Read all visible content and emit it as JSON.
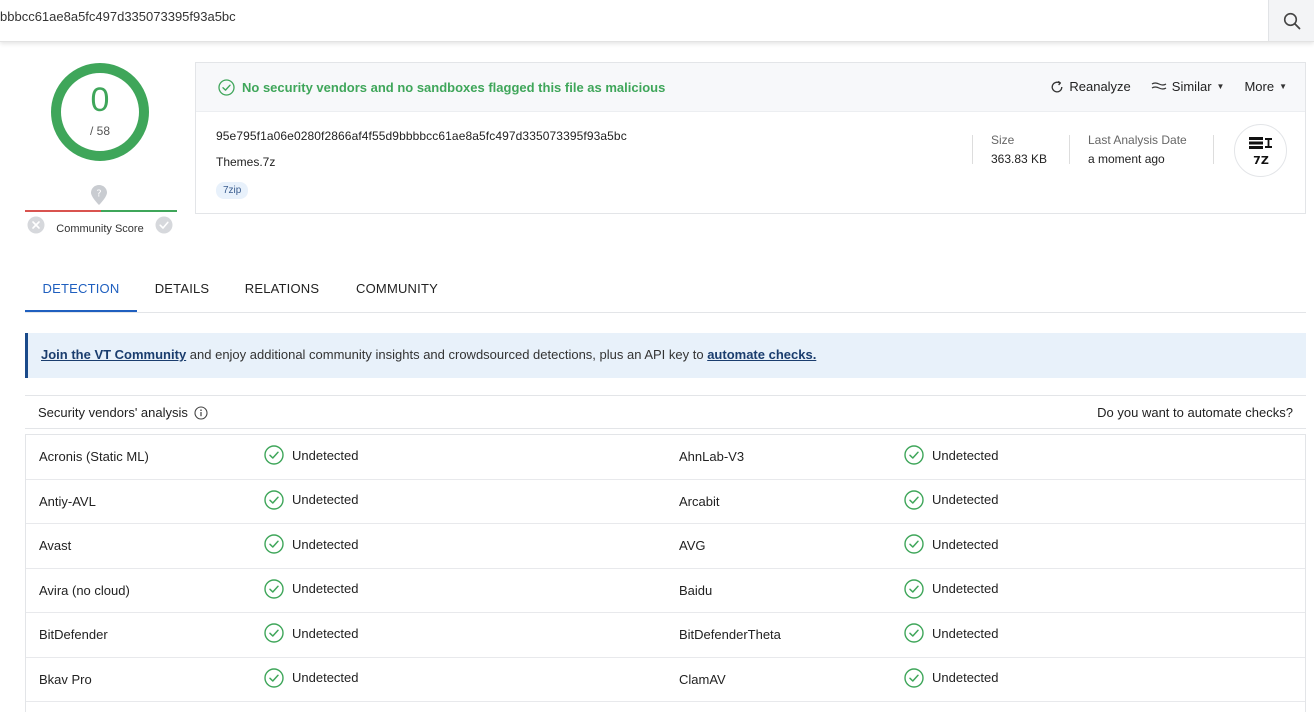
{
  "search": {
    "query": "bbbcc61ae8a5fc497d335073395f93a5bc"
  },
  "score": {
    "detections": "0",
    "total": "/ 58",
    "community_label": "Community Score"
  },
  "status": {
    "message": "No security vendors and no sandboxes flagged this file as malicious"
  },
  "actions": {
    "reanalyze": "Reanalyze",
    "similar": "Similar",
    "more": "More"
  },
  "file": {
    "hash": "95e795f1a06e0280f2866af4f55d9bbbbcc61ae8a5fc497d335073395f93a5bc",
    "name": "Themes.7z",
    "tag": "7zip",
    "size_label": "Size",
    "size_value": "363.83 KB",
    "date_label": "Last Analysis Date",
    "date_value": "a moment ago",
    "type_icon_text": "7Z"
  },
  "tabs": [
    "DETECTION",
    "DETAILS",
    "RELATIONS",
    "COMMUNITY"
  ],
  "banner": {
    "link": "Join the VT Community",
    "text": " and enjoy additional community insights and crowdsourced detections, plus an API key to ",
    "link2": "automate checks."
  },
  "analysis": {
    "title": "Security vendors' analysis",
    "right": "Do you want to automate checks?",
    "rows": [
      {
        "v1": "Acronis (Static ML)",
        "r1": "Undetected",
        "v2": "AhnLab-V3",
        "r2": "Undetected"
      },
      {
        "v1": "Antiy-AVL",
        "r1": "Undetected",
        "v2": "Arcabit",
        "r2": "Undetected"
      },
      {
        "v1": "Avast",
        "r1": "Undetected",
        "v2": "AVG",
        "r2": "Undetected"
      },
      {
        "v1": "Avira (no cloud)",
        "r1": "Undetected",
        "v2": "Baidu",
        "r2": "Undetected"
      },
      {
        "v1": "BitDefender",
        "r1": "Undetected",
        "v2": "BitDefenderTheta",
        "r2": "Undetected"
      },
      {
        "v1": "Bkav Pro",
        "r1": "Undetected",
        "v2": "ClamAV",
        "r2": "Undetected"
      }
    ]
  },
  "colors": {
    "clean": "#3fa65a",
    "accent": "#1f5fbf",
    "malicious": "#d9534f"
  }
}
